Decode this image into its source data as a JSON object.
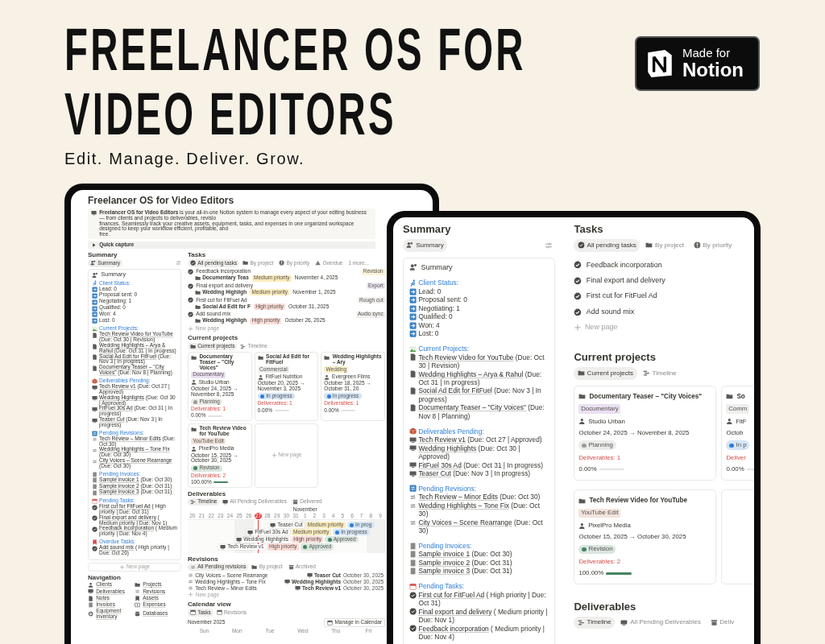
{
  "header": {
    "title_lines": [
      "FREELANCER OS FOR",
      "VIDEO EDITORS"
    ],
    "tagline": "Edit. Manage. Deliver. Grow.",
    "badge": {
      "line1": "Made for",
      "line2": "Notion"
    }
  },
  "left_tablet": {
    "page_title": "Freelancer OS for Video Editors",
    "callout_lines": [
      "**Freelancer OS for Video Editors** is your all-in-one Notion system to manage every aspect of your editing business — from clients and projects to deliverables, revisio",
      "finances. Seamlessly track your creative assets, equipment, tasks, and expenses in one organized workspace designed to keep your workflow efficient, profitable, and",
      "free."
    ],
    "quick_capture": "Quick capture",
    "summary": {
      "heading": "Summary",
      "tabs": [
        {
          "label": "Summary",
          "selected": true
        }
      ],
      "card_title": "Summary",
      "sections": [
        {
          "title": "Client Status:",
          "items": [
            "Lead: 0",
            "Proposal sent: 0",
            "Negotiating: 1",
            "Qualified: 0",
            "Won: 4",
            "Lost: 0"
          ]
        },
        {
          "title": "Current Projects:",
          "items": [
            "**Tech Review Video for YouTube** (Due: Oct 30 | Revision)",
            "**Wedding Highlights – Arya & Rahul** (Due: Oct 31 | In progress)",
            "**Social Ad Edit for FitFuel** (Due: Nov 3 | In progress)",
            "**Documentary Teaser – \"City Voices\"** (Due: Nov 8 | Planning)"
          ]
        },
        {
          "title": "Deliverables Pending:",
          "items": [
            "**Tech Review v1** (Due: Oct 27 | Approved)",
            "**Wedding Highlights** (Due: Oct 30 | Approved)",
            "**FitFuel 30s Ad** (Due: Oct 31 | In progress)",
            "**Teaser Cut** (Due: Nov 3 | In progress)"
          ]
        },
        {
          "title": "Pending Revisions:",
          "items": [
            "**Tech Review – Minor Edits** (Due: Oct 30)",
            "**Wedding Highlights – Tone Fix** (Due: Oct 30)",
            "**City Voices – Scene Rearrange** (Due: Oct 30)"
          ]
        },
        {
          "title": "Pending Invoices:",
          "items": [
            "**Sample invoice 1** (Due: Oct 30)",
            "**Sample invoice 2** (Due: Oct 31)",
            "**Sample invoice 3** (Due: Oct 31)"
          ]
        },
        {
          "title": "Pending Tasks:",
          "items": [
            "**First cut for FitFuel Ad** ( High priority | Due: Oct 31)",
            "**Final export and delivery** ( Medium priority | Due: Nov 1)",
            "**Feedback incorporation** ( Medium priority | Due: Nov 4)"
          ]
        },
        {
          "title": "Overdue Tasks:",
          "items": [
            "**Add sound mix** ( High priority | Due: Oct 26)"
          ]
        }
      ],
      "new_page": "New page"
    },
    "navigation": {
      "heading": "Navigation",
      "items": [
        "Clients",
        "Projects",
        "Deliverables",
        "Revisions",
        "Notes",
        "Assets",
        "Invoices",
        "Expenses",
        "Equipment inventory",
        "Databases"
      ]
    },
    "tasks": {
      "heading": "Tasks",
      "tabs": [
        {
          "label": "All pending tasks",
          "selected": true
        },
        {
          "label": "By project",
          "selected": false
        },
        {
          "label": "By priority",
          "selected": false
        },
        {
          "label": "Overdue",
          "selected": false
        }
      ],
      "more": "1 more...",
      "rows": [
        {
          "name": "Feedback incorporation",
          "tag": {
            "label": "Revision",
            "color": "#fbf3db"
          },
          "project": "Documentary Teas",
          "priority": {
            "label": "Medium priority",
            "color": "#fcecbd"
          },
          "date": "November 4, 2025"
        },
        {
          "name": "Final export and delivery",
          "tag": {
            "label": "Export",
            "color": "#ece4f4"
          },
          "project": "Wedding Highligh",
          "priority": {
            "label": "Medium priority",
            "color": "#fcecbd"
          },
          "date": "November 1, 2025"
        },
        {
          "name": "First cut for FitFuel Ad",
          "tag": {
            "label": "Rough cut",
            "color": "#f0efed"
          },
          "project": "Social Ad Edit for F",
          "priority": {
            "label": "High priority",
            "color": "#fbdcd8"
          },
          "date": "October 31, 2025"
        },
        {
          "name": "Add sound mix",
          "tag": {
            "label": "Audio sync",
            "color": "#f0efed"
          },
          "project": "Wedding Highligh",
          "priority": {
            "label": "High priority",
            "color": "#fbdcd8"
          },
          "date": "October 26, 2025"
        }
      ],
      "new_page": "New page"
    },
    "projects": {
      "heading": "Current projects",
      "tabs": [
        {
          "label": "Current projects",
          "selected": true
        },
        {
          "label": "Timeline",
          "selected": false
        }
      ],
      "cards": [
        {
          "kind": "project",
          "title": "Documentary Teaser – \"City Voices\"",
          "tag": {
            "label": "Documentary",
            "color": "#ebe0f2"
          },
          "client": "Studio Urban",
          "dates": "October 24, 2025 → November 8, 2025",
          "status": {
            "label": "Planning",
            "color": "#9b9a97"
          },
          "deliverables": "Deliverables: 1",
          "percent": "0.00%"
        },
        {
          "kind": "project",
          "title": "Social Ad Edit for FitFuel",
          "tag": {
            "label": "Commercial",
            "color": "#eeeeec"
          },
          "client": "FitFuel Nutrition",
          "dates": "October 20, 2025 → November 3, 2025",
          "status": {
            "label": "In progress",
            "color": "#2e7dd7"
          },
          "deliverables": "Deliverables: 1",
          "percent": "0.00%"
        },
        {
          "kind": "project",
          "title": "Wedding Highlights – Ary",
          "tag": {
            "label": "Wedding",
            "color": "#fbf0c9"
          },
          "client": "Evergreen Films",
          "dates": "October 18, 2025 → October 31, 20",
          "status": {
            "label": "In progress",
            "color": "#2e7dd7"
          },
          "deliverables": "Deliverables: 1",
          "percent": "0.00%"
        },
        {
          "kind": "project",
          "title": "Tech Review Video for YouTube",
          "tag": {
            "label": "YouTube Edit",
            "color": "#f2e3dc"
          },
          "client": "PixelPro Media",
          "dates": "October 15, 2025 → October 30, 2025",
          "status": {
            "label": "Revision",
            "color": "#448361"
          },
          "deliverables": "Deliverables: 2",
          "percent": "100.00%",
          "level": 1
        },
        {
          "kind": "new",
          "label": "New page"
        }
      ]
    },
    "deliverables": {
      "heading": "Deliverables",
      "tabs": [
        {
          "label": "Timeline",
          "selected": true
        },
        {
          "label": "All Pending Deliverables",
          "selected": false
        },
        {
          "label": "Delivered",
          "selected": false
        }
      ],
      "month": "November",
      "days": [
        {
          "label": "20",
          "today": false
        },
        {
          "label": "21",
          "today": false
        },
        {
          "label": "22",
          "today": false
        },
        {
          "label": "23",
          "today": false
        },
        {
          "label": "24",
          "today": false
        },
        {
          "label": "25",
          "today": false
        },
        {
          "label": "26",
          "today": false
        },
        {
          "label": "27",
          "today": true
        },
        {
          "label": "28",
          "today": false
        },
        {
          "label": "29",
          "today": false
        },
        {
          "label": "30",
          "today": false
        },
        {
          "label": "31",
          "today": false
        },
        {
          "label": "1",
          "today": false
        },
        {
          "label": "2",
          "today": false
        },
        {
          "label": "3",
          "today": false
        },
        {
          "label": "4",
          "today": false
        },
        {
          "label": "5",
          "today": false
        },
        {
          "label": "6",
          "today": false
        },
        {
          "label": "7",
          "today": false
        },
        {
          "label": "8",
          "today": false
        },
        {
          "label": "9",
          "today": false
        }
      ],
      "items": [
        {
          "name": "Teaser Cut",
          "priority": {
            "label": "Medium priority",
            "color": "#fcecbd"
          },
          "status": {
            "label": "In prog",
            "color": "#2e7dd7"
          }
        },
        {
          "name": "FitFuel 30s Ad",
          "priority": {
            "label": "Medium priority",
            "color": "#fcecbd"
          },
          "status": {
            "label": "In progress",
            "color": "#2e7dd7"
          }
        },
        {
          "name": "Wedding Highlights",
          "priority": {
            "label": "High priority",
            "color": "#fbdcd8"
          },
          "status": {
            "label": "Approved",
            "color": "#448361"
          }
        },
        {
          "name": "Tech Review v1",
          "priority": {
            "label": "High priority",
            "color": "#fbdcd8"
          },
          "status": {
            "label": "Approved",
            "color": "#448361"
          }
        }
      ]
    },
    "revisions": {
      "heading": "Revisions",
      "tabs": [
        {
          "label": "All Pending revisions",
          "selected": true
        },
        {
          "label": "By project",
          "selected": false
        },
        {
          "label": "Archived",
          "selected": false
        }
      ],
      "rows": [
        {
          "name": "City Voices – Scene Rearrange",
          "deliverable": "Teaser Cut",
          "date": "October 30, 2025"
        },
        {
          "name": "Wedding Highlights – Tone Fix",
          "deliverable": "Wedding Highlights",
          "date": "October 30, 2025"
        },
        {
          "name": "Tech Review – Minor Edits",
          "deliverable": "Tech Review v1",
          "date": "October 30, 2025"
        }
      ],
      "new_page": "New page"
    },
    "calendar": {
      "heading": "Calendar view",
      "tabs": [
        {
          "label": "Tasks",
          "selected": true
        },
        {
          "label": "Revisions",
          "selected": false
        }
      ],
      "month": "November 2025",
      "button": "Manage in Calendar",
      "weekdays": [
        "Sun",
        "Mon",
        "Tue",
        "Wed",
        "Thu",
        "Fri"
      ]
    }
  },
  "right_tablet": {
    "summary": {
      "heading": "Summary",
      "tabs": [
        {
          "label": "Summary",
          "selected": true
        }
      ],
      "card_title": "Summary",
      "sections": [
        {
          "title": "Client Status:",
          "items": [
            "Lead: 0",
            "Proposal sent: 0",
            "Negotiating: 1",
            "Qualified: 0",
            "Won: 4",
            "Lost: 0"
          ]
        },
        {
          "title": "Current Projects:",
          "items": [
            "**Tech Review Video for YouTube** (Due: Oct 30 | Revision)",
            "**Wedding Highlights – Arya & Rahul** (Due: Oct 31 | In progress)",
            "**Social Ad Edit for FitFuel** (Due: Nov 3 | In progress)",
            "**Documentary Teaser – \"City Voices\"** (Due: Nov 8 | Planning)"
          ]
        },
        {
          "title": "Deliverables Pending:",
          "items": [
            "**Tech Review v1** (Due: Oct 27 | Approved)",
            "**Wedding Highlights** (Due: Oct 30 | Approved)",
            "**FitFuel 30s Ad** (Due: Oct 31 | In progress)",
            "**Teaser Cut** (Due: Nov 3 | In progress)"
          ]
        },
        {
          "title": "Pending Revisions:",
          "items": [
            "**Tech Review – Minor Edits** (Due: Oct 30)",
            "**Wedding Highlights – Tone Fix** (Due: Oct 30)",
            "**City Voices – Scene Rearrange** (Due: Oct 30)"
          ]
        },
        {
          "title": "Pending Invoices:",
          "items": [
            "**Sample invoice 1** (Due: Oct 30)",
            "**Sample invoice 2** (Due: Oct 31)",
            "**Sample invoice 3** (Due: Oct 31)"
          ]
        },
        {
          "title": "Pending Tasks:",
          "items": [
            "**First cut for FitFuel Ad** ( High priority | Due: Oct 31)",
            "**Final export and delivery** ( Medium priority | Due: Nov 1)",
            "**Feedback incorporation** ( Medium priority | Due: Nov 4)"
          ]
        }
      ]
    },
    "tasks": {
      "heading": "Tasks",
      "tabs": [
        {
          "label": "All pending tasks",
          "selected": true
        },
        {
          "label": "By project",
          "selected": false
        },
        {
          "label": "By priority",
          "selected": false
        }
      ],
      "rows": [
        {
          "name": "Feedback incorporation"
        },
        {
          "name": "Final export and delivery"
        },
        {
          "name": "First cut for FitFuel Ad"
        },
        {
          "name": "Add sound mix"
        }
      ],
      "new_page": "New page"
    },
    "projects": {
      "heading": "Current projects",
      "tabs": [
        {
          "label": "Current projects",
          "selected": true
        },
        {
          "label": "Timeline",
          "selected": false
        }
      ],
      "cards": [
        {
          "kind": "project",
          "title": "Documentary Teaser – \"City Voices\"",
          "tag": {
            "label": "Documentary",
            "color": "#ebe0f2"
          },
          "client": "Studio Urban",
          "dates": "October 24, 2025 → November 8, 2025",
          "status": {
            "label": "Planning",
            "color": "#9b9a97"
          },
          "deliverables": "Deliverables: 1",
          "percent": "0.00%"
        },
        {
          "kind": "project",
          "title": "So",
          "tag": {
            "label": "Comm",
            "color": "#eeeeec"
          },
          "client": "FitF",
          "dates": "Octob",
          "status": {
            "label": "In p",
            "color": "#2e7dd7"
          },
          "deliverables": "Deliver",
          "percent": "0.00%"
        },
        {
          "kind": "project",
          "title": "Tech Review Video for YouTube",
          "tag": {
            "label": "YouTube Edit",
            "color": "#f2e3dc"
          },
          "client": "PixelPro Media",
          "dates": "October 15, 2025 → October 30, 2025",
          "status": {
            "label": "Revision",
            "color": "#448361"
          },
          "deliverables": "Deliverables: 2",
          "percent": "100.00%",
          "level": 1
        },
        {
          "kind": "empty"
        }
      ]
    },
    "deliverables": {
      "heading": "Deliverables",
      "tabs": [
        {
          "label": "Timeline",
          "selected": true
        },
        {
          "label": "All Pending Deliverables",
          "selected": false
        },
        {
          "label": "Deliv",
          "selected": false
        }
      ]
    }
  }
}
